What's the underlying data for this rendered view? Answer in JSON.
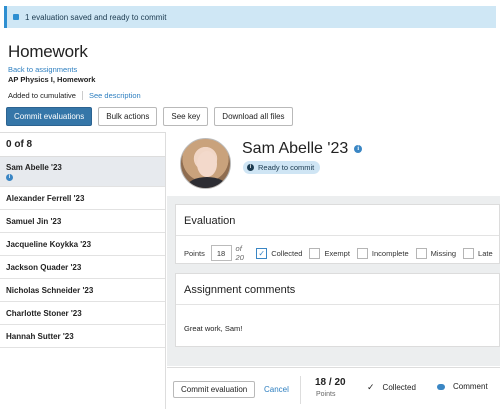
{
  "banner": {
    "text": "1 evaluation saved and ready to commit"
  },
  "header": {
    "title": "Homework",
    "back_link": "Back to assignments",
    "course": "AP Physics I, Homework",
    "cumulative": "Added to cumulative",
    "description_link": "See description"
  },
  "toolbar": {
    "commit_evaluations": "Commit evaluations",
    "bulk_actions": "Bulk actions",
    "see_key": "See key",
    "download_all": "Download all files"
  },
  "student_list": {
    "count": "0 of 8",
    "students": [
      "Sam Abelle '23",
      "Alexander Ferrell '23",
      "Samuel Jin '23",
      "Jacqueline Koykka '23",
      "Jackson Quader '23",
      "Nicholas Schneider '23",
      "Charlotte Stoner '23",
      "Hannah Sutter '23"
    ]
  },
  "student": {
    "name": "Sam Abelle '23",
    "status": "Ready to commit"
  },
  "evaluation": {
    "heading": "Evaluation",
    "points_label": "Points",
    "points_value": "18",
    "points_of": "of 20",
    "options": [
      {
        "label": "Collected",
        "checked": true
      },
      {
        "label": "Exempt",
        "checked": false
      },
      {
        "label": "Incomplete",
        "checked": false
      },
      {
        "label": "Missing",
        "checked": false
      },
      {
        "label": "Late",
        "checked": false
      }
    ]
  },
  "comments": {
    "heading": "Assignment comments",
    "text": "Great work, Sam!"
  },
  "footer": {
    "commit_button": "Commit evaluation",
    "cancel": "Cancel",
    "score": "18 / 20",
    "points_label": "Points",
    "collected": "Collected",
    "comment": "Comment"
  },
  "colors": {
    "accent": "#3576a8",
    "link": "#2e7fc0",
    "banner": "#cfe7f5"
  }
}
